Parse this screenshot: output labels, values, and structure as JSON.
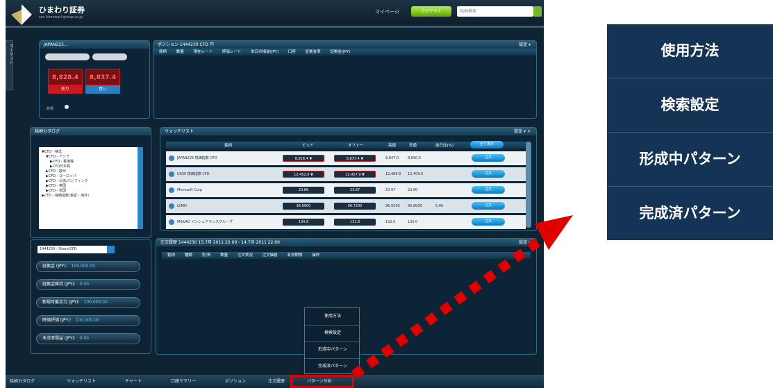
{
  "header": {
    "logo_name": "ひまわり証券",
    "logo_sub": "sec.himawari-group.co.jp",
    "mypage": "マイページ",
    "green_button": "ログアウト",
    "search_placeholder": "銘柄検索"
  },
  "side_tab": {
    "label": "マーケット"
  },
  "quote_panel": {
    "title": "JAPAN225...",
    "sell_price": "8,828.4",
    "buy_price": "8,837.4",
    "sell_label": "売り",
    "buy_label": "買い",
    "lot_label": "数量"
  },
  "position_panel": {
    "title": "ポジション 1444230 CFD 円",
    "menu": "設定 ▾",
    "columns": [
      "銘柄",
      "数量",
      "現在レート",
      "評価レート",
      "本日の損益(JPY)",
      "口座",
      "証拠金率",
      "証拠金(JPY)"
    ]
  },
  "catalog_panel": {
    "title": "銘柄カタログ",
    "tree": [
      "▼CFD - 株式",
      "▼CFD - アジア",
      "▶CFD - 香港株",
      "▶CFD日本株",
      "▶CFD - 欧州",
      "▶CFD - ヨーロッパ",
      "▶CFD - 北米/パシフィック",
      "▶CFD - 英国",
      "▶CFD - 米国",
      "▶CFD - 株価指数(東証・海外)"
    ]
  },
  "watchlist_panel": {
    "title": "ウォッチリスト",
    "menu": "設定 ▾ ×",
    "columns": [
      "銘柄",
      "ビッド",
      "オファー",
      "高値",
      "安値",
      "前日比(%)",
      "全て表示"
    ],
    "rows": [
      {
        "name": "JAPAN225 株価指数 CFD",
        "bid": "8,828.4 ▼",
        "offer": "8,837.4 ▼",
        "high": "8,847.0",
        "low": "8,690.5",
        "chg": "",
        "btn": "注文"
      },
      {
        "name": "US30 株価指数 CFD",
        "bid": "12,452.9 ▼",
        "offer": "12,457.9 ▼",
        "high": "12,489.8",
        "low": "12,409.0",
        "chg": "",
        "btn": "注文"
      },
      {
        "name": "Microsoft Corp",
        "bid": "23.86",
        "offer": "23.87",
        "high": "23.97",
        "low": "23.80",
        "chg": "",
        "btn": "注文"
      },
      {
        "name": "LVMH",
        "bid": "96.6900",
        "offer": "96.7200",
        "high": "96.9100",
        "low": "95.8000",
        "chg": "0.00",
        "btn": "注文"
      },
      {
        "name": "MS&AD インシュアランスグループ",
        "bid": "130.8",
        "offer": "131.8",
        "high": "132.0",
        "low": "130.0",
        "chg": "",
        "btn": "注文"
      }
    ]
  },
  "account_panel": {
    "select": "1444230 - Share/CFD",
    "rows": [
      {
        "label": "証拠金 (JPY):",
        "value": "100,000.00"
      },
      {
        "label": "証拠金維持 (JPY):",
        "value": "0.00"
      },
      {
        "label": "新規可能余力 (JPY):",
        "value": "100,000.00"
      },
      {
        "label": "時価評価 (JPY):",
        "value": "100,000.00"
      },
      {
        "label": "未決済損益 (JPY):",
        "value": "0.00"
      }
    ]
  },
  "order_panel": {
    "title": "注文履歴 1444230 15.7月 2011 22:00 - 14.7月 2011 22:00",
    "menu": "設定 ▾",
    "columns": [
      "銘柄",
      "種類",
      "売/買",
      "数量",
      "注文状況",
      "注文価格",
      "有効期限",
      "操作"
    ]
  },
  "popup_menu": {
    "items": [
      "使用方法",
      "検索設定",
      "形成中パターン",
      "完成済パターン"
    ]
  },
  "bottom_bar": {
    "tabs": [
      "銘柄カタログ",
      "ウォッチリスト",
      "チャート",
      "口座サマリー",
      "ポジション",
      "注文履歴",
      "パターン分析"
    ]
  },
  "zoom_menu": {
    "items": [
      "使用方法",
      "検索設定",
      "形成中パターン",
      "完成済パターン"
    ]
  },
  "colors": {
    "highlight_red": "#e00000",
    "menu_blue": "#153455",
    "sell_red": "#c9191e",
    "buy_blue": "#2a7fc0"
  }
}
